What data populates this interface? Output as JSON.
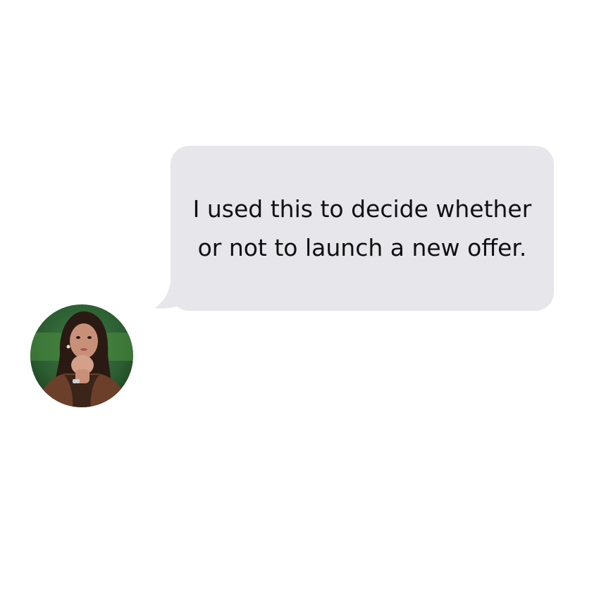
{
  "message": {
    "text": "I used this to decide whether or not to launch a new offer."
  },
  "avatar": {
    "icon": "person-photo"
  },
  "colors": {
    "background": "#ffffff",
    "bubble": "#e6e6eb",
    "text": "#111111"
  }
}
